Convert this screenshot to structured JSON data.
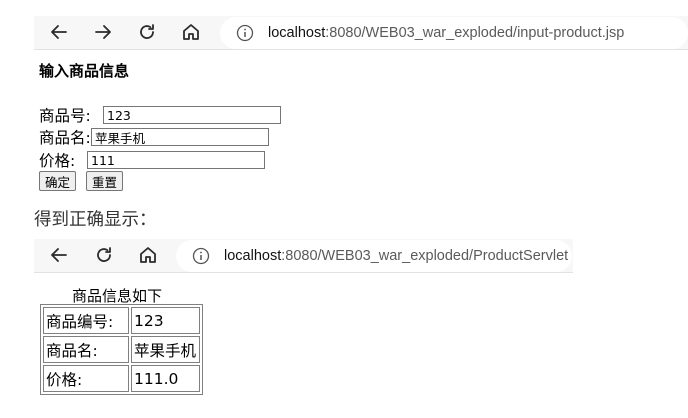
{
  "browser1": {
    "url_host": "localhost",
    "url_rest": ":8080/WEB03_war_exploded/input-product.jsp"
  },
  "form_page": {
    "heading": "输入商品信息",
    "fields": [
      {
        "label": "商品号:",
        "value": "123"
      },
      {
        "label": "商品名:",
        "value": "苹果手机"
      },
      {
        "label": "价格:",
        "value": "111"
      }
    ],
    "submit_label": "确定",
    "reset_label": "重置"
  },
  "result_note": "得到正确显示：",
  "browser2": {
    "url_host": "localhost",
    "url_rest": ":8080/WEB03_war_exploded/ProductServlet"
  },
  "result_page": {
    "caption": "商品信息如下",
    "rows": [
      {
        "label": "商品编号:",
        "value": "123"
      },
      {
        "label": "商品名:",
        "value": "苹果手机"
      },
      {
        "label": "价格:",
        "value": "111.0"
      }
    ]
  },
  "icons": [
    "back-arrow-icon",
    "forward-arrow-icon",
    "reload-icon",
    "home-icon",
    "info-icon"
  ]
}
